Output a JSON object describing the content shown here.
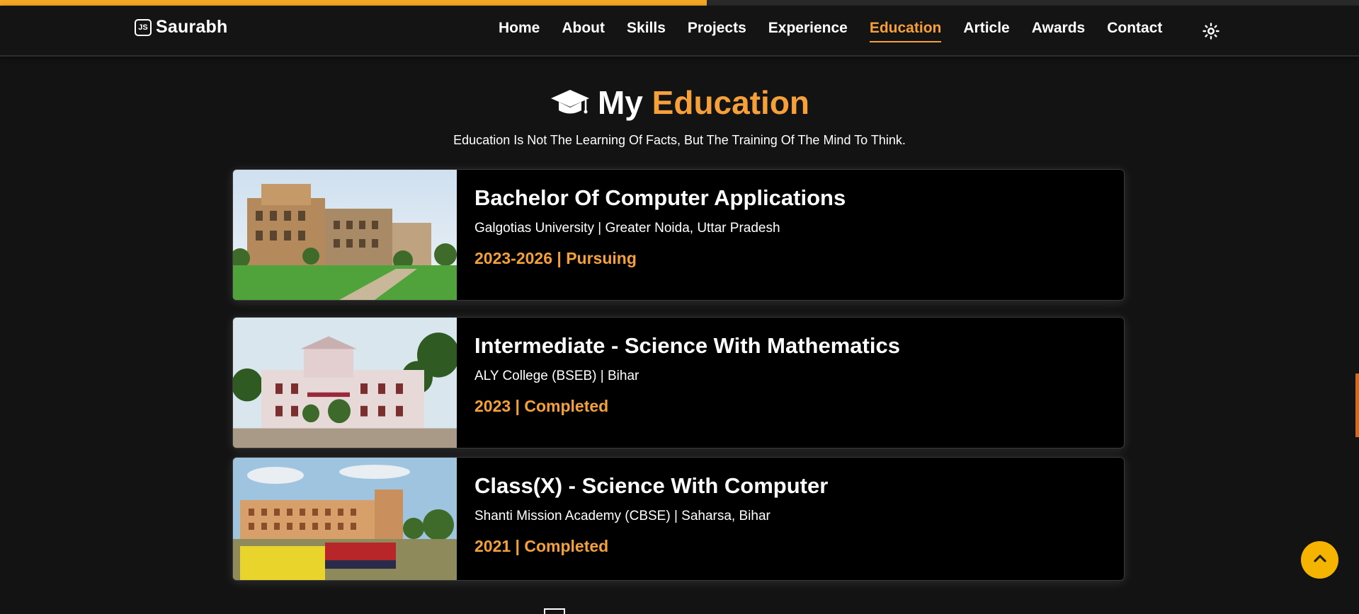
{
  "scroll_progress_percent": 52,
  "logo": {
    "icon": "js-logo-icon",
    "icon_text": "JS",
    "name": "Saurabh"
  },
  "nav": {
    "items": [
      {
        "label": "Home"
      },
      {
        "label": "About"
      },
      {
        "label": "Skills"
      },
      {
        "label": "Projects"
      },
      {
        "label": "Experience"
      },
      {
        "label": "Education",
        "active": true
      },
      {
        "label": "Article"
      },
      {
        "label": "Awards"
      },
      {
        "label": "Contact"
      }
    ],
    "theme_toggle_icon": "sun-icon"
  },
  "section": {
    "icon": "graduation-cap-icon",
    "title_main": "My",
    "title_accent": "Education",
    "tagline": "Education Is Not The Learning Of Facts, But The Training Of The Mind To Think."
  },
  "education": [
    {
      "degree": "Bachelor Of Computer Applications",
      "school": "Galgotias University | Greater Noida, Uttar Pradesh",
      "status": "2023-2026 | Pursuing"
    },
    {
      "degree": "Intermediate - Science With Mathematics",
      "school": "ALY College (BSEB) | Bihar",
      "status": "2023 | Completed"
    },
    {
      "degree": "Class(X) - Science With Computer",
      "school": "Shanti Mission Academy (CBSE) | Saharsa, Bihar",
      "status": "2021 | Completed"
    }
  ],
  "scroll_top_icon": "chevron-up-icon",
  "colors": {
    "accent": "#f5a03a",
    "progress": "#f5a623",
    "background": "#131313",
    "card": "#000000"
  }
}
